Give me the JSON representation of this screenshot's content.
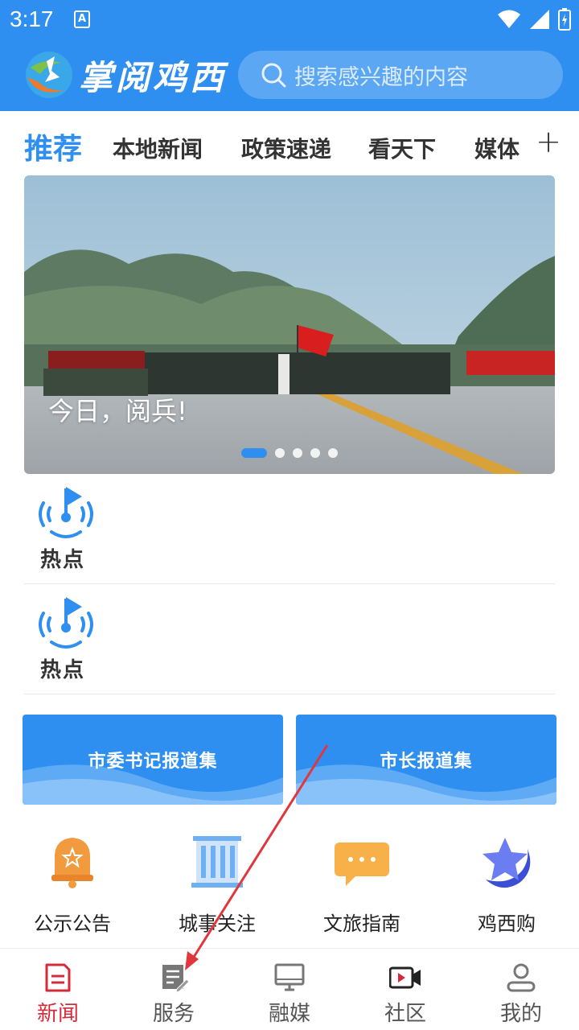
{
  "status": {
    "time": "3:17",
    "badge": "A"
  },
  "header": {
    "logo_text": "掌阅鸡西",
    "search_placeholder": "搜索感兴趣的内容"
  },
  "tabs": [
    {
      "label": "推荐",
      "active": true
    },
    {
      "label": "本地新闻",
      "active": false
    },
    {
      "label": "政策速递",
      "active": false
    },
    {
      "label": "看天下",
      "active": false
    },
    {
      "label": "媒体",
      "active": false
    }
  ],
  "tab_add": "+",
  "banner": {
    "caption": "今日，阅兵!",
    "slide_count": 5,
    "active_slide": 1
  },
  "hot_items": [
    {
      "label": "热点"
    },
    {
      "label": "热点"
    }
  ],
  "report_cards": [
    {
      "label": "市委书记报道集"
    },
    {
      "label": "市长报道集"
    }
  ],
  "services": [
    {
      "label": "公示公告",
      "icon": "bell-icon"
    },
    {
      "label": "城事关注",
      "icon": "building-icon"
    },
    {
      "label": "文旅指南",
      "icon": "chat-bubble-icon"
    },
    {
      "label": "鸡西购",
      "icon": "star-icon"
    }
  ],
  "bottom_nav": [
    {
      "label": "新闻",
      "icon": "news-doc-icon",
      "active": true
    },
    {
      "label": "服务",
      "icon": "service-edit-icon",
      "active": false
    },
    {
      "label": "融媒",
      "icon": "monitor-icon",
      "active": false
    },
    {
      "label": "社区",
      "icon": "video-icon",
      "active": false
    },
    {
      "label": "我的",
      "icon": "user-icon",
      "active": false
    }
  ],
  "colors": {
    "brand": "#2f8ff0",
    "nav_active": "#d42b3a",
    "annotation_arrow": "#e0373e"
  }
}
